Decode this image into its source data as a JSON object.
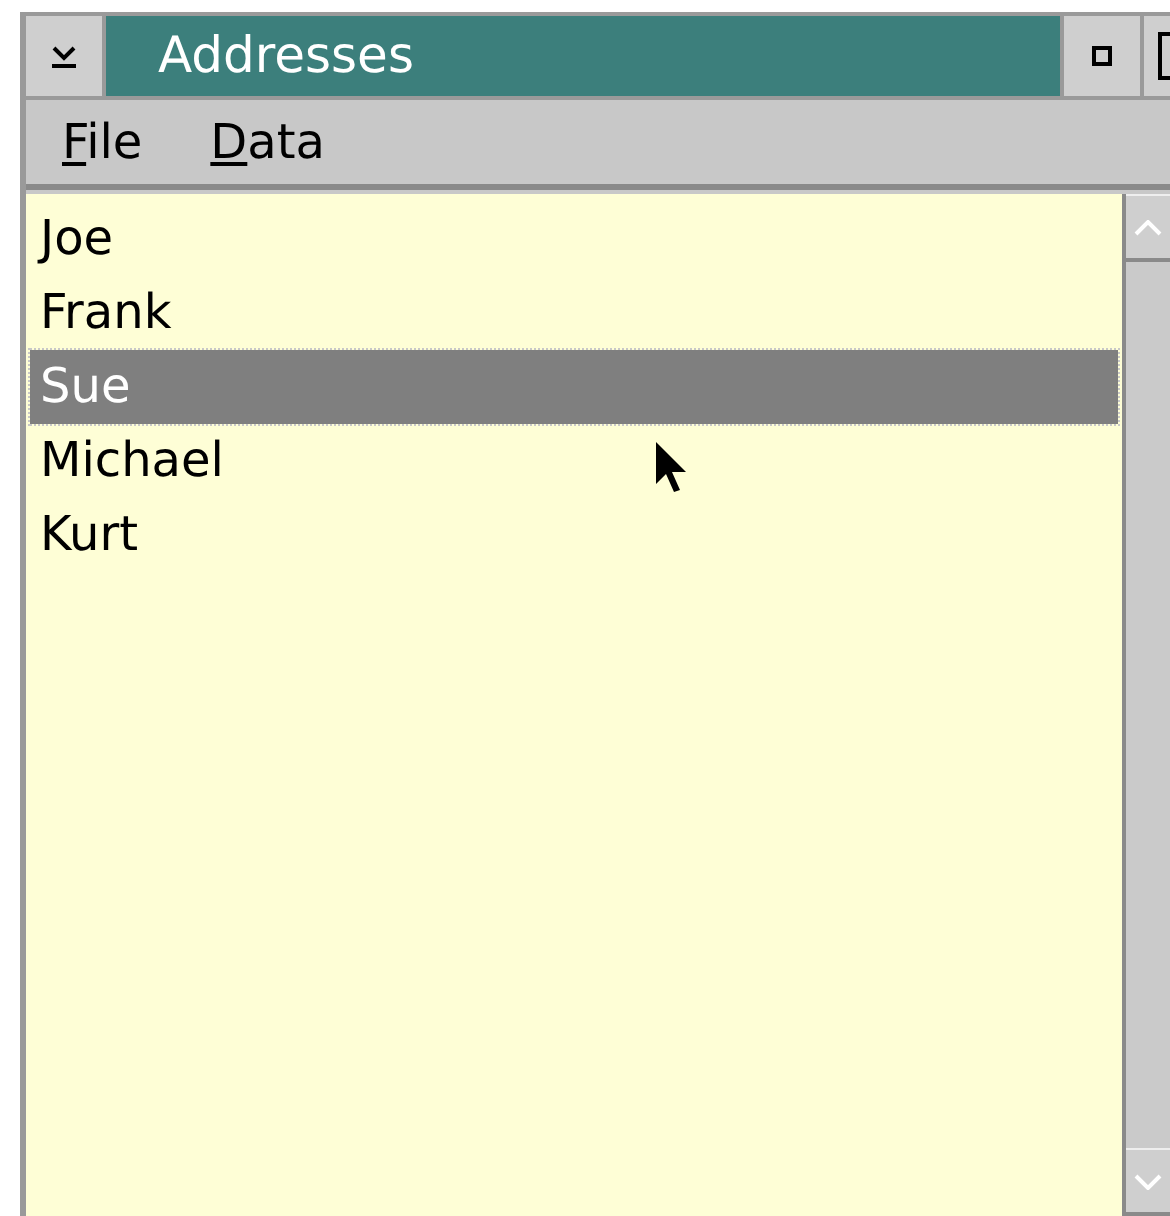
{
  "window": {
    "title": "Addresses"
  },
  "menu": [
    {
      "label": "File"
    },
    {
      "label": "Data"
    }
  ],
  "list": [
    {
      "label": "Joe",
      "selected": false
    },
    {
      "label": "Frank",
      "selected": false
    },
    {
      "label": "Sue",
      "selected": true
    },
    {
      "label": "Michael",
      "selected": false
    },
    {
      "label": "Kurt",
      "selected": false
    }
  ]
}
